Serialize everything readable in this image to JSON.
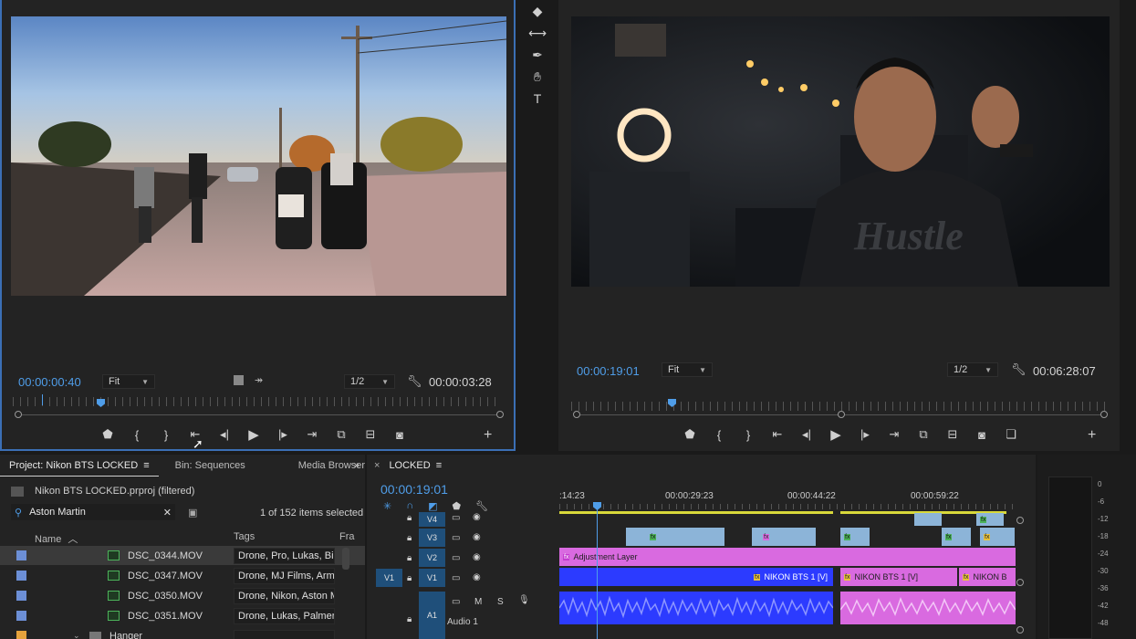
{
  "source_monitor": {
    "timecode_current": "00:00:00:40",
    "fit_label": "Fit",
    "resolution_label": "1/2",
    "timecode_duration": "00:00:03:28"
  },
  "program_monitor": {
    "timecode_current": "00:00:19:01",
    "fit_label": "Fit",
    "resolution_label": "1/2",
    "timecode_duration": "00:06:28:07"
  },
  "tools": [
    "track-select-icon",
    "ripple-edit-icon",
    "pen-icon",
    "hand-icon",
    "type-icon"
  ],
  "project": {
    "tabs": [
      "Project: Nikon BTS LOCKED",
      "Bin: Sequences",
      "Media Browser"
    ],
    "file_name": "Nikon BTS LOCKED.prproj (filtered)",
    "search_value": "Aston Martin",
    "items_count": "1 of 152 items selected",
    "col_name": "Name",
    "col_tags": "Tags",
    "col_frame": "Fra",
    "rows": [
      {
        "name": "DSC_0344.MOV",
        "tags": "Drone, Pro, Lukas, Biker"
      },
      {
        "name": "DSC_0347.MOV",
        "tags": "Drone, MJ Films, Armar"
      },
      {
        "name": "DSC_0350.MOV",
        "tags": "Drone, Nikon, Aston Ma"
      },
      {
        "name": "DSC_0351.MOV",
        "tags": "Drone, Lukas, Palmer, M"
      }
    ],
    "folder_name": "Hanger"
  },
  "timeline": {
    "sequence_name": "LOCKED",
    "timecode": "00:00:19:01",
    "ruler": [
      ":14:23",
      "00:00:29:23",
      "00:00:44:22",
      "00:00:59:22"
    ],
    "tracks": [
      "V4",
      "V3",
      "V2",
      "V1",
      "A1"
    ],
    "source_patch": "V1",
    "adjustment_layer": "Adjustment Layer",
    "clip_v1_a": "NIKON BTS 1 [V]",
    "clip_v1_b": "NIKON BTS 1 [V]",
    "clip_v1_c": "NIKON B",
    "audio_track_name": "Audio 1",
    "audio_buttons": [
      "M",
      "S"
    ]
  },
  "meters": [
    "0",
    "-6",
    "-12",
    "-18",
    "-24",
    "-30",
    "-36",
    "-42",
    "-48"
  ],
  "colors": {
    "accent_blue": "#4f9de8",
    "panel_bg": "#232323",
    "adjustment_pink": "#d96ae0",
    "v1_blue": "#2c3bff"
  }
}
